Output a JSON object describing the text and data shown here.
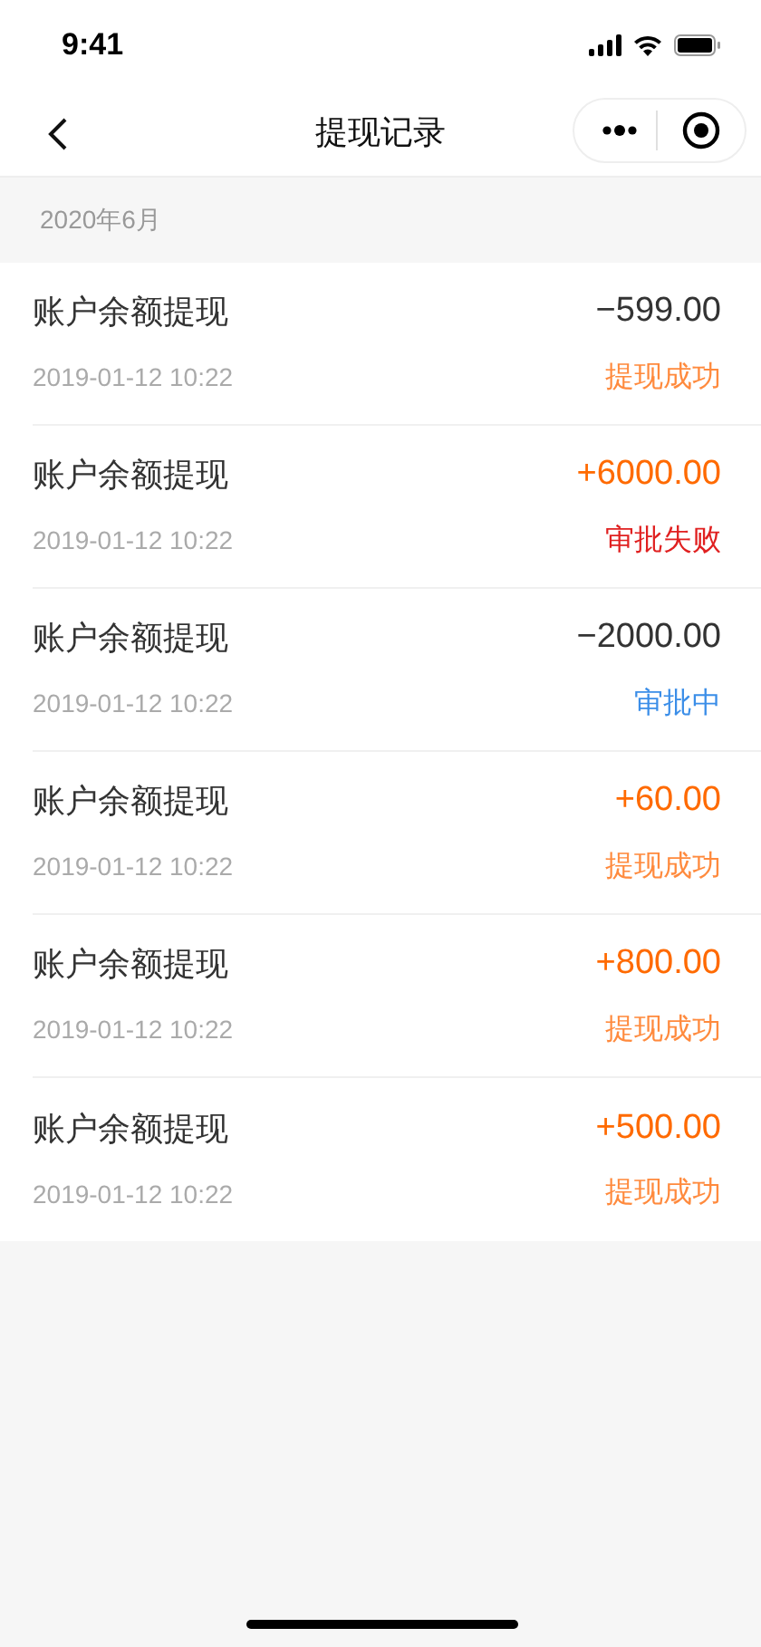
{
  "status_bar": {
    "time": "9:41"
  },
  "nav": {
    "title": "提现记录"
  },
  "section": {
    "title": "2020年6月"
  },
  "records": [
    {
      "title": "账户余额提现",
      "time": "2019-01-12 10:22",
      "amount": {
        "text": "−599.00",
        "color": "#333333"
      },
      "status": {
        "text": "提现成功",
        "color": "#ff8a3d"
      }
    },
    {
      "title": "账户余额提现",
      "time": "2019-01-12 10:22",
      "amount": {
        "text": "+6000.00",
        "color": "#ff6a00"
      },
      "status": {
        "text": "审批失败",
        "color": "#e02020"
      }
    },
    {
      "title": "账户余额提现",
      "time": "2019-01-12 10:22",
      "amount": {
        "text": "−2000.00",
        "color": "#333333"
      },
      "status": {
        "text": "审批中",
        "color": "#3b8ee8"
      }
    },
    {
      "title": "账户余额提现",
      "time": "2019-01-12 10:22",
      "amount": {
        "text": "+60.00",
        "color": "#ff6a00"
      },
      "status": {
        "text": "提现成功",
        "color": "#ff8a3d"
      }
    },
    {
      "title": "账户余额提现",
      "time": "2019-01-12 10:22",
      "amount": {
        "text": "+800.00",
        "color": "#ff6a00"
      },
      "status": {
        "text": "提现成功",
        "color": "#ff8a3d"
      }
    },
    {
      "title": "账户余额提现",
      "time": "2019-01-12 10:22",
      "amount": {
        "text": "+500.00",
        "color": "#ff6a00"
      },
      "status": {
        "text": "提现成功",
        "color": "#ff8a3d"
      }
    }
  ]
}
